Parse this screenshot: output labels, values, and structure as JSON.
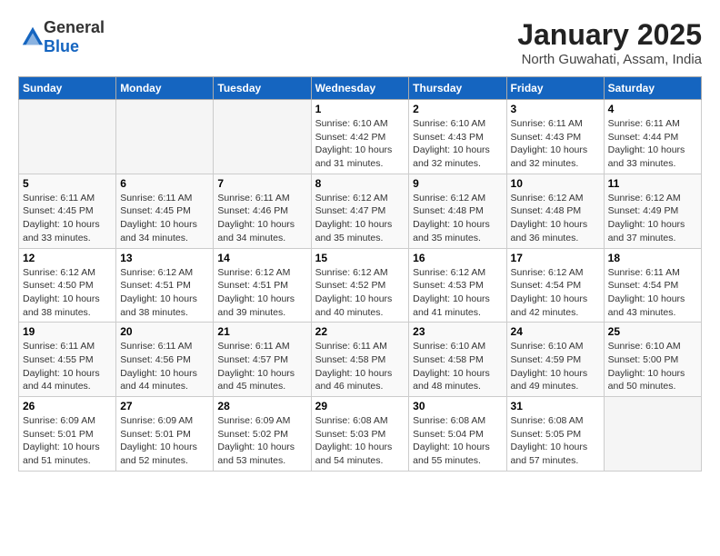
{
  "header": {
    "logo_general": "General",
    "logo_blue": "Blue",
    "month": "January 2025",
    "location": "North Guwahati, Assam, India"
  },
  "weekdays": [
    "Sunday",
    "Monday",
    "Tuesday",
    "Wednesday",
    "Thursday",
    "Friday",
    "Saturday"
  ],
  "weeks": [
    [
      {
        "day": "",
        "sunrise": "",
        "sunset": "",
        "daylight": ""
      },
      {
        "day": "",
        "sunrise": "",
        "sunset": "",
        "daylight": ""
      },
      {
        "day": "",
        "sunrise": "",
        "sunset": "",
        "daylight": ""
      },
      {
        "day": "1",
        "sunrise": "6:10 AM",
        "sunset": "4:42 PM",
        "daylight": "10 hours and 31 minutes."
      },
      {
        "day": "2",
        "sunrise": "6:10 AM",
        "sunset": "4:43 PM",
        "daylight": "10 hours and 32 minutes."
      },
      {
        "day": "3",
        "sunrise": "6:11 AM",
        "sunset": "4:43 PM",
        "daylight": "10 hours and 32 minutes."
      },
      {
        "day": "4",
        "sunrise": "6:11 AM",
        "sunset": "4:44 PM",
        "daylight": "10 hours and 33 minutes."
      }
    ],
    [
      {
        "day": "5",
        "sunrise": "6:11 AM",
        "sunset": "4:45 PM",
        "daylight": "10 hours and 33 minutes."
      },
      {
        "day": "6",
        "sunrise": "6:11 AM",
        "sunset": "4:45 PM",
        "daylight": "10 hours and 34 minutes."
      },
      {
        "day": "7",
        "sunrise": "6:11 AM",
        "sunset": "4:46 PM",
        "daylight": "10 hours and 34 minutes."
      },
      {
        "day": "8",
        "sunrise": "6:12 AM",
        "sunset": "4:47 PM",
        "daylight": "10 hours and 35 minutes."
      },
      {
        "day": "9",
        "sunrise": "6:12 AM",
        "sunset": "4:48 PM",
        "daylight": "10 hours and 35 minutes."
      },
      {
        "day": "10",
        "sunrise": "6:12 AM",
        "sunset": "4:48 PM",
        "daylight": "10 hours and 36 minutes."
      },
      {
        "day": "11",
        "sunrise": "6:12 AM",
        "sunset": "4:49 PM",
        "daylight": "10 hours and 37 minutes."
      }
    ],
    [
      {
        "day": "12",
        "sunrise": "6:12 AM",
        "sunset": "4:50 PM",
        "daylight": "10 hours and 38 minutes."
      },
      {
        "day": "13",
        "sunrise": "6:12 AM",
        "sunset": "4:51 PM",
        "daylight": "10 hours and 38 minutes."
      },
      {
        "day": "14",
        "sunrise": "6:12 AM",
        "sunset": "4:51 PM",
        "daylight": "10 hours and 39 minutes."
      },
      {
        "day": "15",
        "sunrise": "6:12 AM",
        "sunset": "4:52 PM",
        "daylight": "10 hours and 40 minutes."
      },
      {
        "day": "16",
        "sunrise": "6:12 AM",
        "sunset": "4:53 PM",
        "daylight": "10 hours and 41 minutes."
      },
      {
        "day": "17",
        "sunrise": "6:12 AM",
        "sunset": "4:54 PM",
        "daylight": "10 hours and 42 minutes."
      },
      {
        "day": "18",
        "sunrise": "6:11 AM",
        "sunset": "4:54 PM",
        "daylight": "10 hours and 43 minutes."
      }
    ],
    [
      {
        "day": "19",
        "sunrise": "6:11 AM",
        "sunset": "4:55 PM",
        "daylight": "10 hours and 44 minutes."
      },
      {
        "day": "20",
        "sunrise": "6:11 AM",
        "sunset": "4:56 PM",
        "daylight": "10 hours and 44 minutes."
      },
      {
        "day": "21",
        "sunrise": "6:11 AM",
        "sunset": "4:57 PM",
        "daylight": "10 hours and 45 minutes."
      },
      {
        "day": "22",
        "sunrise": "6:11 AM",
        "sunset": "4:58 PM",
        "daylight": "10 hours and 46 minutes."
      },
      {
        "day": "23",
        "sunrise": "6:10 AM",
        "sunset": "4:58 PM",
        "daylight": "10 hours and 48 minutes."
      },
      {
        "day": "24",
        "sunrise": "6:10 AM",
        "sunset": "4:59 PM",
        "daylight": "10 hours and 49 minutes."
      },
      {
        "day": "25",
        "sunrise": "6:10 AM",
        "sunset": "5:00 PM",
        "daylight": "10 hours and 50 minutes."
      }
    ],
    [
      {
        "day": "26",
        "sunrise": "6:09 AM",
        "sunset": "5:01 PM",
        "daylight": "10 hours and 51 minutes."
      },
      {
        "day": "27",
        "sunrise": "6:09 AM",
        "sunset": "5:01 PM",
        "daylight": "10 hours and 52 minutes."
      },
      {
        "day": "28",
        "sunrise": "6:09 AM",
        "sunset": "5:02 PM",
        "daylight": "10 hours and 53 minutes."
      },
      {
        "day": "29",
        "sunrise": "6:08 AM",
        "sunset": "5:03 PM",
        "daylight": "10 hours and 54 minutes."
      },
      {
        "day": "30",
        "sunrise": "6:08 AM",
        "sunset": "5:04 PM",
        "daylight": "10 hours and 55 minutes."
      },
      {
        "day": "31",
        "sunrise": "6:08 AM",
        "sunset": "5:05 PM",
        "daylight": "10 hours and 57 minutes."
      },
      {
        "day": "",
        "sunrise": "",
        "sunset": "",
        "daylight": ""
      }
    ]
  ]
}
